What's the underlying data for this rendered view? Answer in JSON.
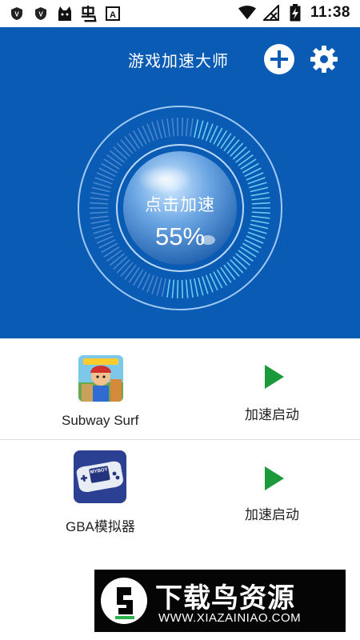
{
  "status_bar": {
    "time": "11:38",
    "left_icons": [
      "shield-v-icon",
      "shield-v-icon",
      "cat-icon",
      "chong-app-icon",
      "a-box-icon"
    ],
    "right_icons": [
      "wifi-icon",
      "no-signal-icon",
      "battery-charging-icon"
    ]
  },
  "header": {
    "title": "游戏加速大师",
    "add_icon": "plus-circle-icon",
    "settings_icon": "gear-icon"
  },
  "accelerator": {
    "label": "点击加速",
    "percent_text": "55%",
    "percent_value": 55
  },
  "games": [
    {
      "name": "Subway Surf",
      "action": "加速启动",
      "icon": "subway-surf-icon"
    },
    {
      "name": "GBA模拟器",
      "action": "加速启动",
      "icon": "gba-console-icon"
    }
  ],
  "watermark": {
    "title": "下载鸟资源",
    "url": "WWW.XIAZAINIAO.COM"
  },
  "colors": {
    "header_bg": "#0a5bb3",
    "play_green": "#1a9a3b",
    "text": "#222222"
  }
}
